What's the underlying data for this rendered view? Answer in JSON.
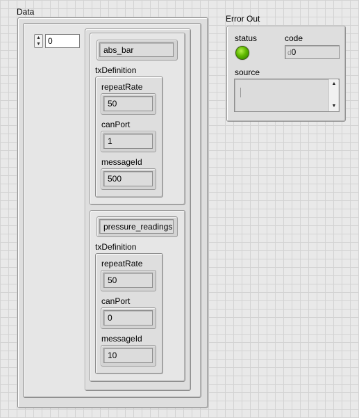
{
  "data_label": "Data",
  "array_index": "0",
  "elements": [
    {
      "name": "abs_bar",
      "tx_definition_label": "txDefinition",
      "repeat_rate_label": "repeatRate",
      "repeat_rate": "50",
      "can_port_label": "canPort",
      "can_port": "1",
      "message_id_label": "messageId",
      "message_id": "500"
    },
    {
      "name": "pressure_readings",
      "tx_definition_label": "txDefinition",
      "repeat_rate_label": "repeatRate",
      "repeat_rate": "50",
      "can_port_label": "canPort",
      "can_port": "0",
      "message_id_label": "messageId",
      "message_id": "10"
    }
  ],
  "error_out": {
    "title": "Error Out",
    "status_label": "status",
    "code_label": "code",
    "code_radix": "d",
    "code_value": "0",
    "source_label": "source",
    "source_value": "",
    "status_color": "#5fb800"
  }
}
